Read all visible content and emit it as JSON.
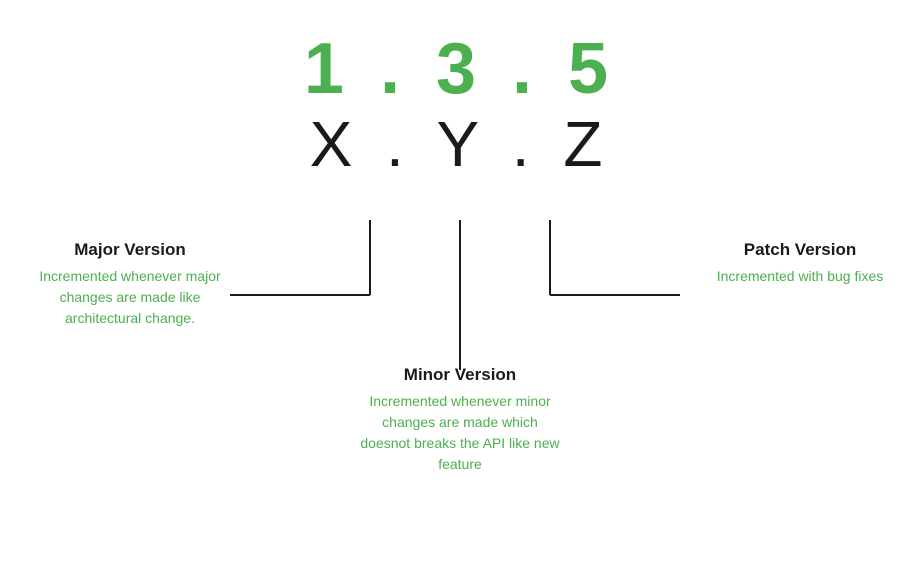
{
  "version": {
    "number": "1 . 3 . 5",
    "xyz": "X . Y . Z"
  },
  "major": {
    "title": "Major Version",
    "description": "Incremented whenever major changes are made like architectural change."
  },
  "minor": {
    "title": "Minor Version",
    "description": "Incremented whenever minor changes are made which doesnot breaks the API like new feature"
  },
  "patch": {
    "title": "Patch Version",
    "description": "Incremented with bug fixes"
  }
}
